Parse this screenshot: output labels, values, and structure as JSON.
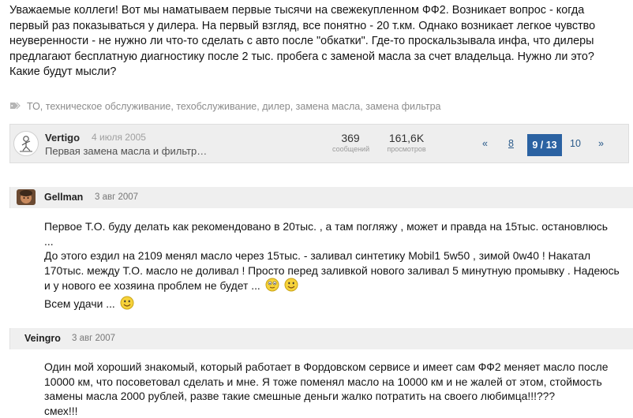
{
  "intro": {
    "lines": [
      "Уважаемые коллеги! Вот мы наматываем первые тысячи на свежекупленном ФФ2. Возникает вопрос - когда",
      "первый раз показываться у дилера. На первый взгляд, все понятно - 20 т.км. Однако возникает легкое чувство",
      "неуверенности - не нужно ли что-то сделать с авто после \"обкатки\". Где-то проскальзывала инфа, что дилеры",
      "предлагают бесплатную диагностику после 2 тыс. пробега с заменой масла за счет владельца. Нужно ли это?",
      "Какие будут мысли?"
    ]
  },
  "tags": [
    "ТО",
    "техническое обслуживание",
    "техобслуживание",
    "дилер",
    "замена масла",
    "замена фильтра"
  ],
  "thread": {
    "author": "Vertigo",
    "date": "4 июля 2005",
    "title": "Первая замена масла и фильтр…",
    "replies": "369",
    "replies_label": "сообщений",
    "views": "161,6K",
    "views_label": "просмотров"
  },
  "pagination": {
    "prev": "«",
    "prev_page": "8",
    "current": "9 / 13",
    "next_page": "10",
    "next": "»"
  },
  "posts": [
    {
      "author": "Gellman",
      "date": "3 авг 2007",
      "lines": [
        "Первое Т.О. буду делать как рекомендовано в 20тыс. , а там погляжу , может и правда на 15тыс. остановлюсь",
        "...",
        "До этого ездил на 2109 менял масло через 15тыс. - заливал синтетику Mobil1 5w50 , зимой 0w40 ! Накатал",
        "170тыс. между Т.О. масло не доливал ! Просто перед заливкой нового заливал 5 минутную промывку . Надеюсь",
        "и у нового ее хозяина проблем не будет ...",
        "Всем удачи ..."
      ]
    },
    {
      "author": "Veingro",
      "date": "3 авг 2007",
      "lines": [
        "Один мой хороший знакомый, который работает в Фордовском сервисе и имеет сам ФФ2 меняет масло после",
        "10000 км, что посоветовал сделать и мне. Я тоже поменял масло на 10000 км и не жалей от этом, стоймость",
        "замены масла 2000 рублей, разве такие смешные деньги жалко потратить на своего любимца!!!???",
        "смех!!!"
      ]
    }
  ],
  "colors": {
    "accent": "#2b62a2",
    "header_bg": "#efefef",
    "muted": "#8c8c8c"
  },
  "icons": {
    "tag": "tag-icon",
    "avatar_vertigo": "stick-figure-avatar",
    "avatar_gellman": "photo-avatar",
    "smiley": "smiley-icon"
  }
}
